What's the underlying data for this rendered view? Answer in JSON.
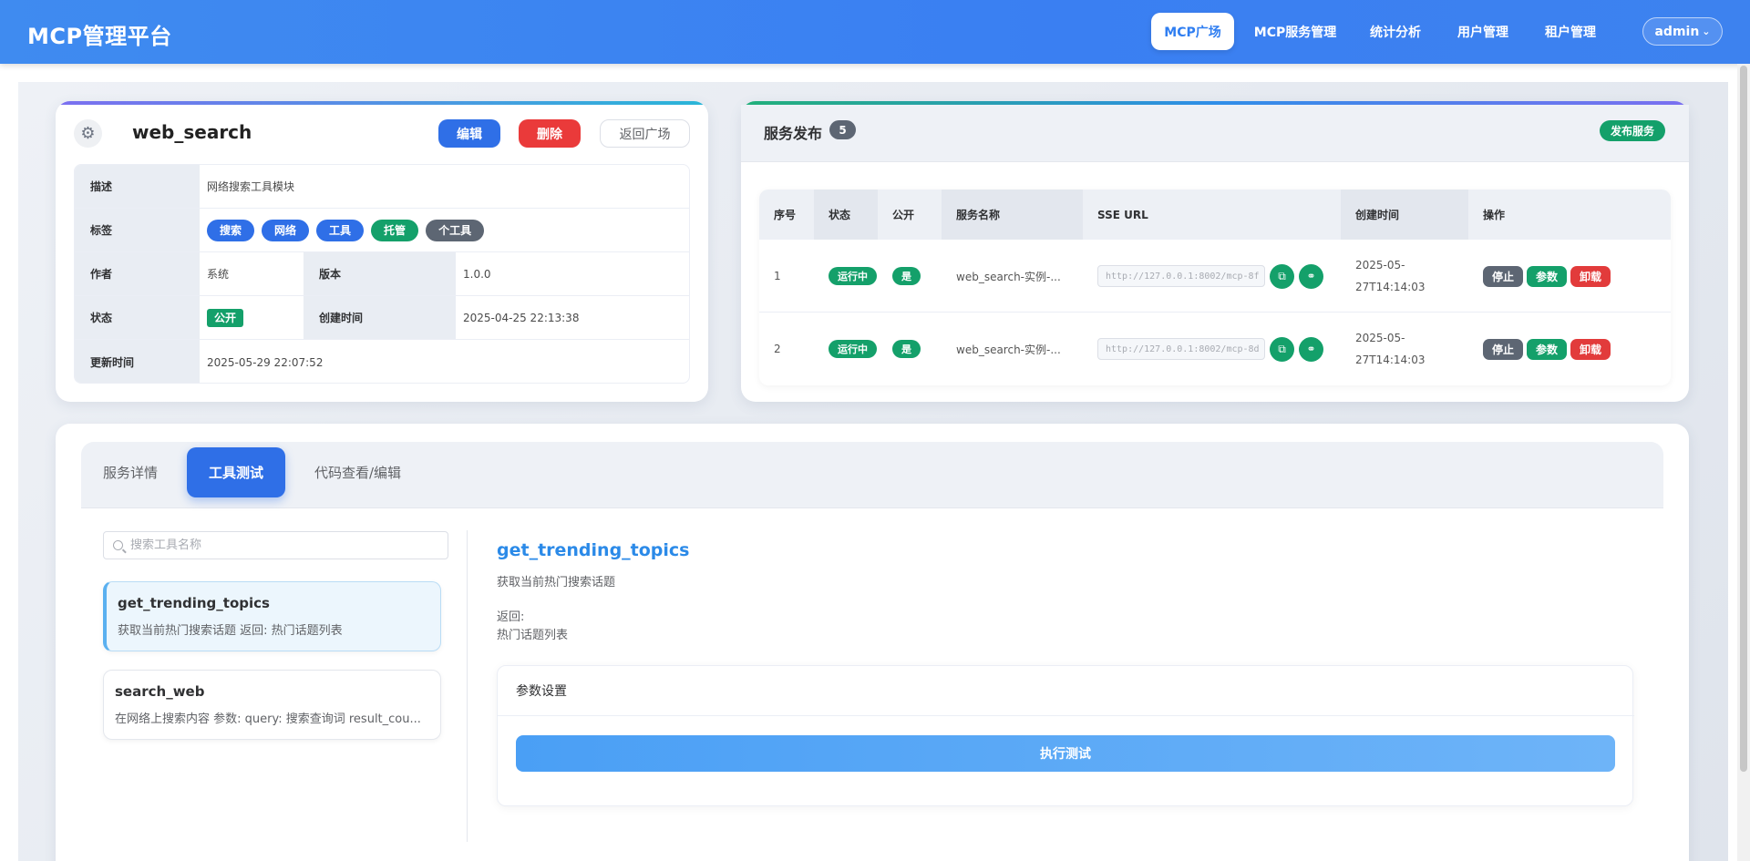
{
  "app": {
    "title": "MCP管理平台"
  },
  "nav": {
    "items": [
      "MCP广场",
      "MCP服务管理",
      "统计分析",
      "用户管理",
      "租户管理"
    ],
    "user": "admin"
  },
  "service": {
    "name": "web_search",
    "buttons": {
      "edit": "编辑",
      "delete": "删除",
      "back": "返回广场"
    },
    "info": {
      "desc_label": "描述",
      "desc": "网络搜索工具模块",
      "tags_label": "标签",
      "tags": [
        "搜索",
        "网络",
        "工具",
        "托管",
        "个工具"
      ],
      "author_label": "作者",
      "author": "系统",
      "version_label": "版本",
      "version": "1.0.0",
      "status_label": "状态",
      "status": "公开",
      "created_label": "创建时间",
      "created": "2025-04-25 22:13:38",
      "updated_label": "更新时间",
      "updated": "2025-05-29 22:07:52"
    }
  },
  "publish": {
    "title": "服务发布",
    "count": "5",
    "button": "发布服务",
    "columns": [
      "序号",
      "状态",
      "公开",
      "服务名称",
      "SSE URL",
      "创建时间",
      "操作"
    ],
    "rows": [
      {
        "no": "1",
        "status": "运行中",
        "public": "是",
        "name": "web_search-实例-...",
        "url": "http://127.0.0.1:8002/mcp-8f",
        "created_line1": "2025-05-",
        "created_line2": "27T14:14:03"
      },
      {
        "no": "2",
        "status": "运行中",
        "public": "是",
        "name": "web_search-实例-...",
        "url": "http://127.0.0.1:8002/mcp-8d",
        "created_line1": "2025-05-",
        "created_line2": "27T14:14:03"
      }
    ],
    "ops": {
      "stop": "停止",
      "params": "参数",
      "unload": "卸载"
    }
  },
  "tabs": [
    "服务详情",
    "工具测试",
    "代码查看/编辑"
  ],
  "tools": {
    "search_placeholder": "搜索工具名称",
    "items": [
      {
        "name": "get_trending_topics",
        "desc": "获取当前热门搜索话题 返回: 热门话题列表"
      },
      {
        "name": "search_web",
        "desc": "在网络上搜索内容 参数: query: 搜索查询词 result_cou..."
      }
    ]
  },
  "detail": {
    "title": "get_trending_topics",
    "desc": "获取当前热门搜索话题",
    "return_label": "返回:",
    "return_value": "热门话题列表",
    "param_title": "参数设置",
    "run_button": "执行测试"
  },
  "colors": {
    "primary": "#2f6fe7",
    "success": "#14a06a",
    "danger": "#ea3a3a",
    "header": "#3a7ff2"
  }
}
